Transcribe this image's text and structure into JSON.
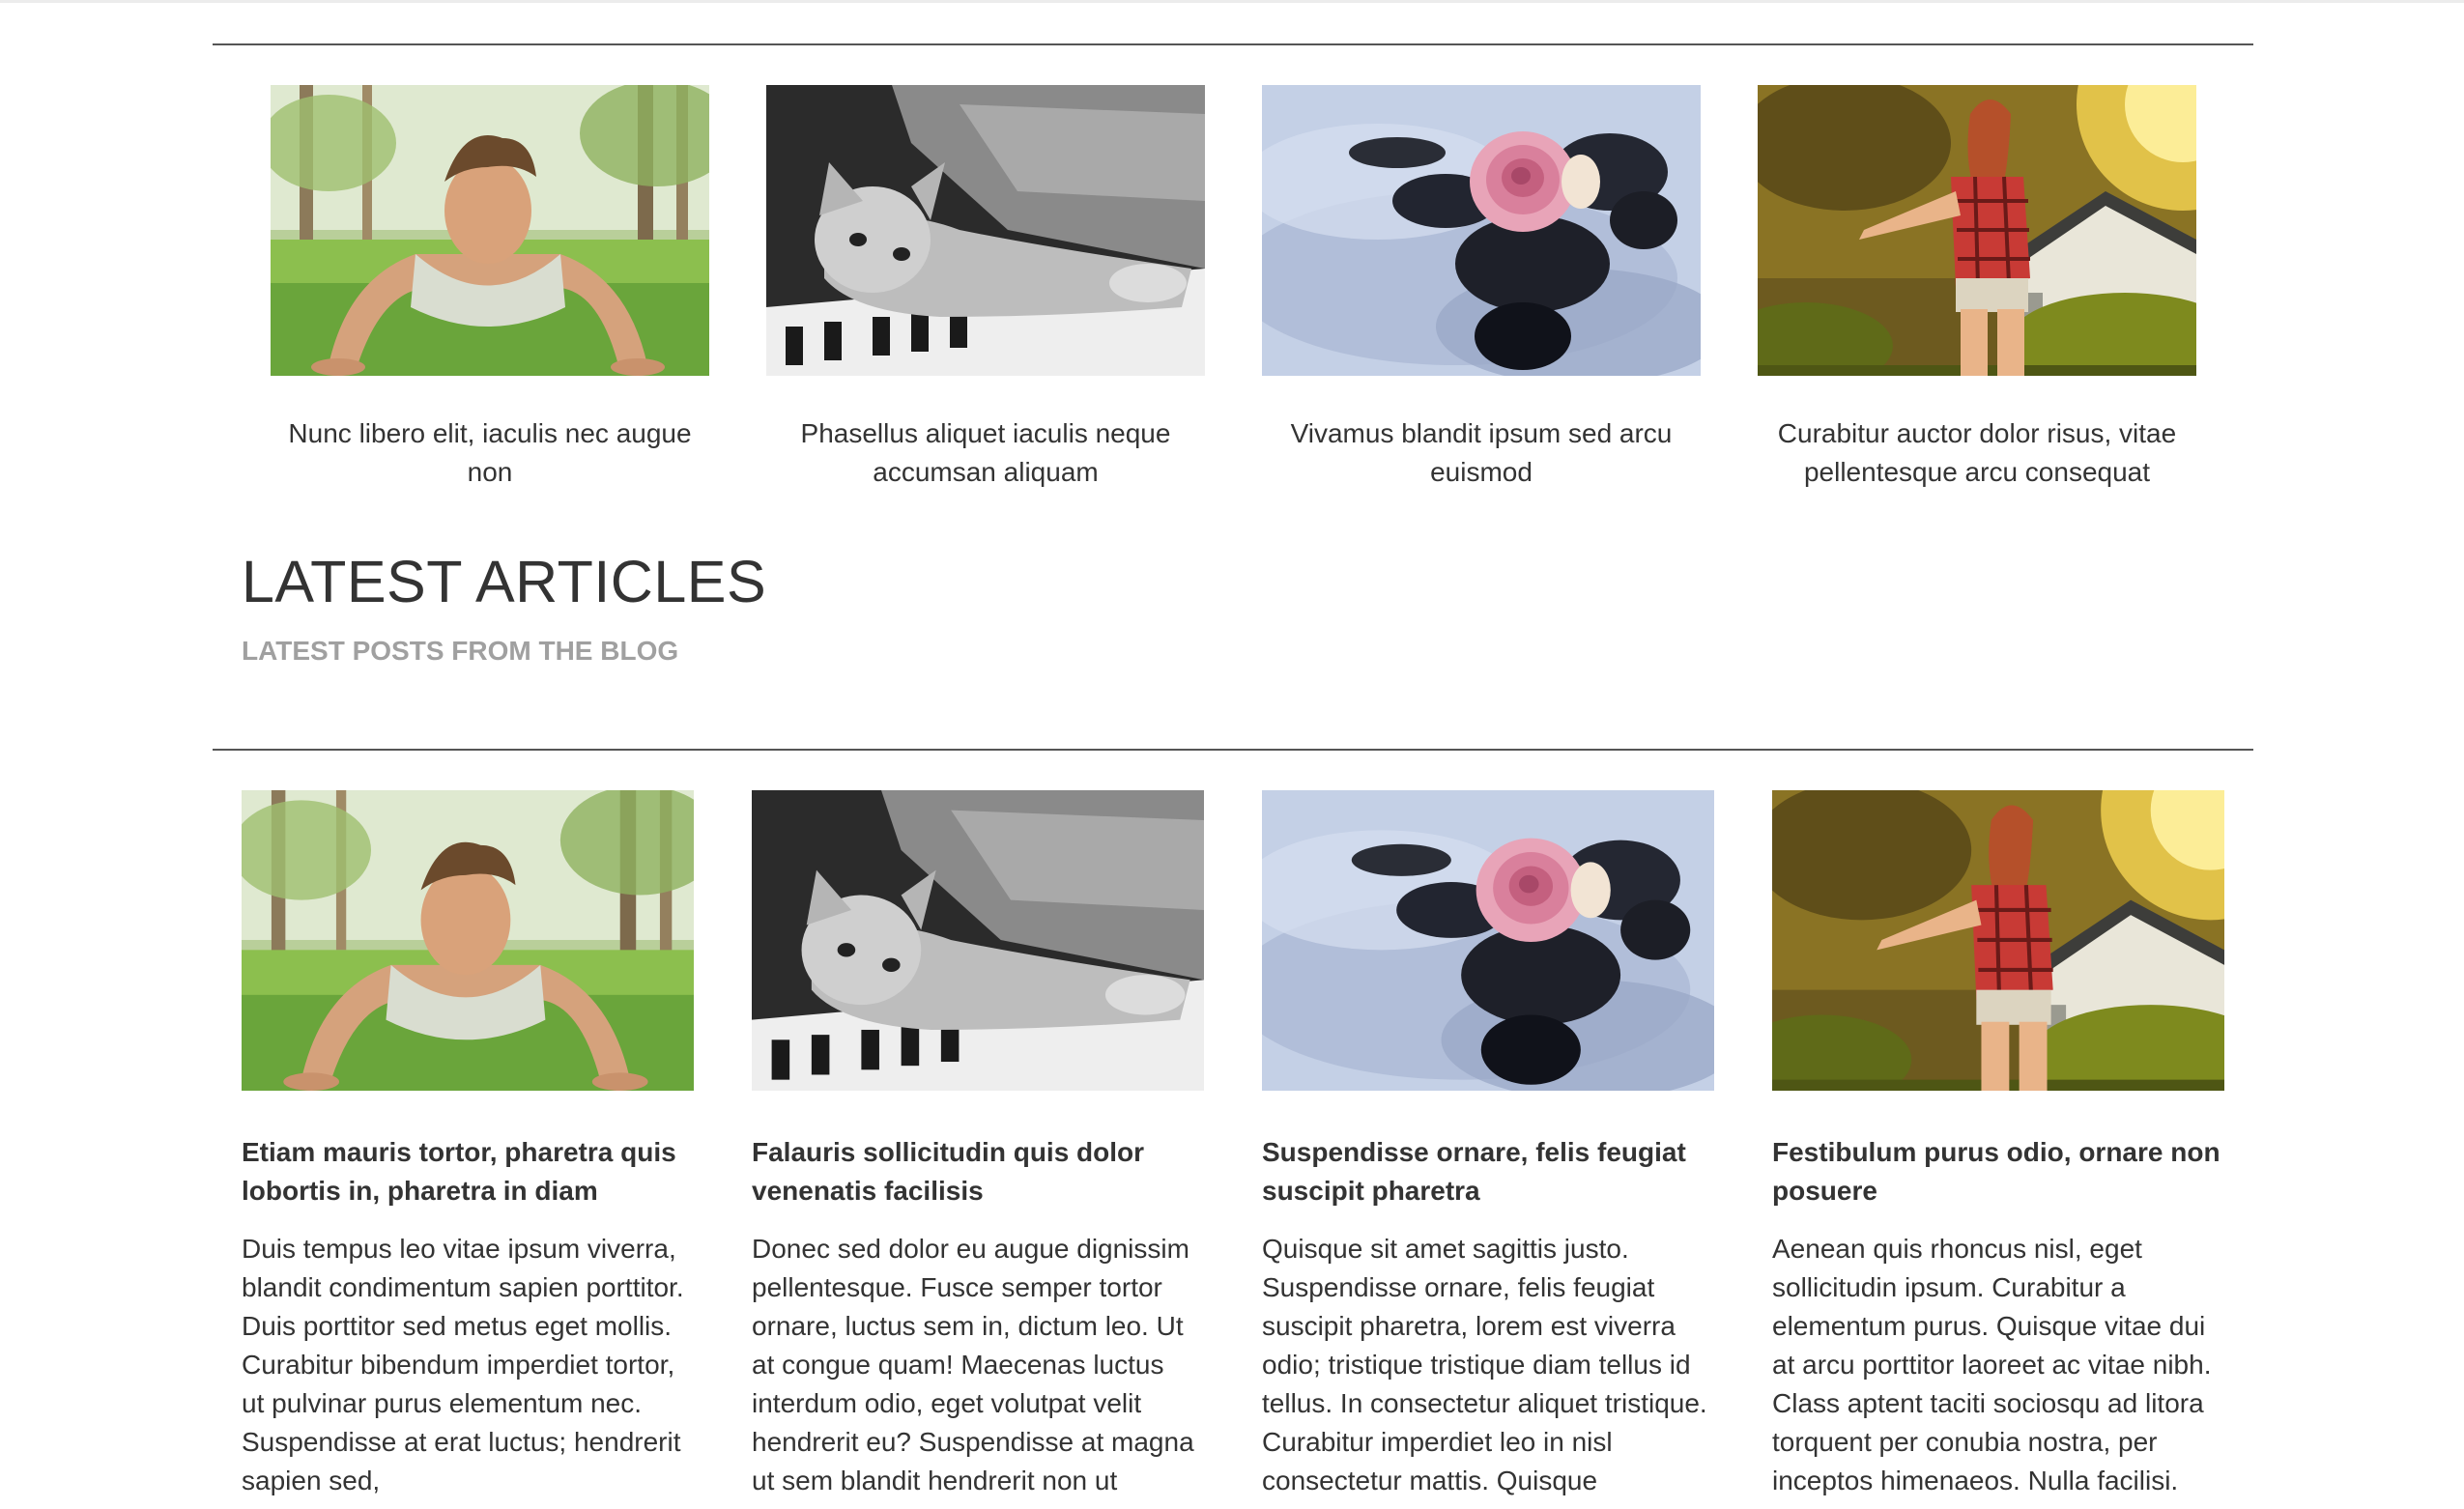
{
  "gallery": [
    {
      "image": "man-doing-pushups-in-park",
      "caption": "Nunc libero elit, iaculis nec augue non"
    },
    {
      "image": "kitten-lying-on-piano-keys",
      "caption": "Phasellus aliquet iaculis neque accumsan aliquam"
    },
    {
      "image": "pink-rose-on-black-stones-in-water",
      "caption": "Vivamus blandit ipsum sed arcu euismod"
    },
    {
      "image": "woman-in-plaid-shirt-in-sunlight",
      "caption": "Curabitur auctor dolor risus, vitae pellentesque arcu consequat"
    }
  ],
  "section": {
    "title": "LATEST ARTICLES",
    "subtitle": "LATEST POSTS FROM THE BLOG"
  },
  "articles": [
    {
      "image": "man-doing-pushups-in-park",
      "title": "Etiam mauris tortor, pharetra quis lobortis in, pharetra in diam",
      "excerpt": "Duis tempus leo vitae ipsum viverra, blandit condimentum sapien porttitor. Duis porttitor sed metus eget mollis. Curabitur bibendum imperdiet tortor, ut pulvinar purus elementum nec. Suspendisse at erat luctus; hendrerit sapien sed,"
    },
    {
      "image": "kitten-lying-on-piano-keys",
      "title": "Falauris sollicitudin quis dolor venenatis facilisis",
      "excerpt": "Donec sed dolor eu augue dignissim pellentesque. Fusce semper tortor ornare, luctus sem in, dictum leo. Ut at congue quam! Maecenas luctus interdum odio, eget volutpat velit hendrerit eu? Suspendisse at magna ut sem blandit hendrerit non ut"
    },
    {
      "image": "pink-rose-on-black-stones-in-water",
      "title": "Suspendisse ornare, felis feugiat suscipit pharetra",
      "excerpt": "Quisque sit amet sagittis justo. Suspendisse ornare, felis feugiat suscipit pharetra, lorem est viverra odio; tristique tristique diam tellus id tellus. In consectetur aliquet tristique. Curabitur imperdiet leo in nisl consectetur mattis. Quisque"
    },
    {
      "image": "woman-in-plaid-shirt-in-sunlight",
      "title": "Festibulum purus odio, ornare non posuere",
      "excerpt": "Aenean quis rhoncus nisl, eget sollicitudin ipsum. Curabitur a elementum purus. Quisque vitae dui at arcu porttitor laoreet ac vitae nibh. Class aptent taciti sociosqu ad litora torquent per conubia nostra, per inceptos himenaeos. Nulla facilisi."
    }
  ]
}
